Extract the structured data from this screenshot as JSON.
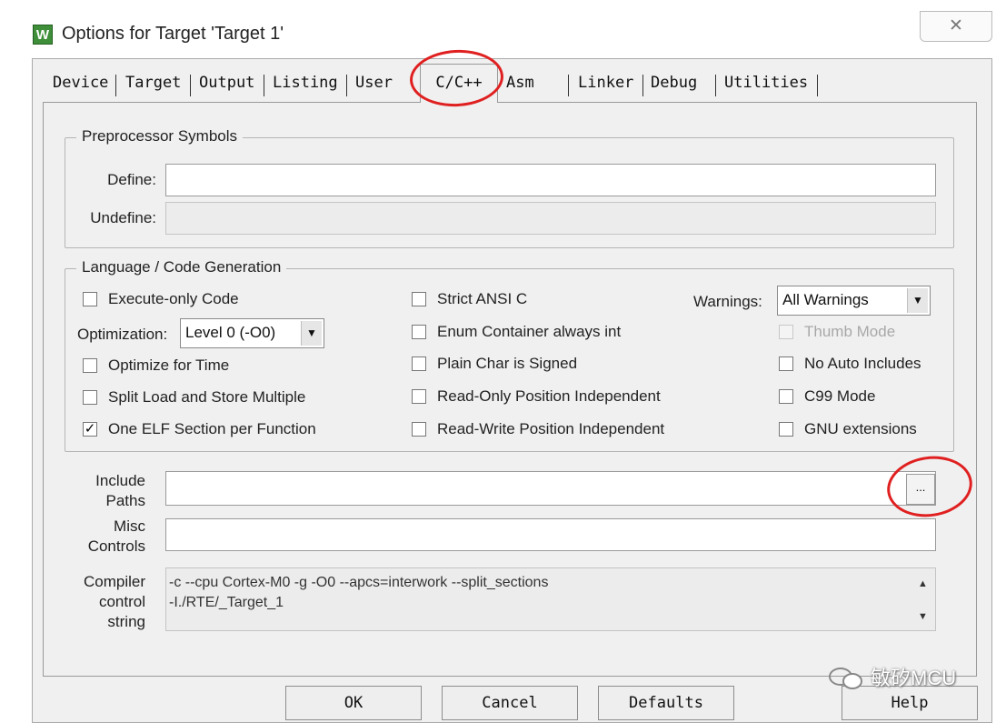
{
  "window": {
    "title": "Options for Target 'Target 1'",
    "close_glyph": "✕"
  },
  "tabs": [
    {
      "label": "Device"
    },
    {
      "label": "Target"
    },
    {
      "label": "Output"
    },
    {
      "label": "Listing"
    },
    {
      "label": "User"
    },
    {
      "label": "C/C++",
      "active": true
    },
    {
      "label": "Asm"
    },
    {
      "label": "Linker"
    },
    {
      "label": "Debug"
    },
    {
      "label": "Utilities"
    }
  ],
  "preprocessor": {
    "group_label": "Preprocessor Symbols",
    "define_label": "Define:",
    "define_value": "",
    "undefine_label": "Undefine:",
    "undefine_value": ""
  },
  "language": {
    "group_label": "Language / Code Generation",
    "execute_only": {
      "label": "Execute-only Code",
      "checked": false
    },
    "optimization": {
      "label": "Optimization:",
      "value": "Level 0 (-O0)"
    },
    "optimize_time": {
      "label": "Optimize for Time",
      "checked": false
    },
    "split_load": {
      "label": "Split Load and Store Multiple",
      "checked": false
    },
    "one_elf": {
      "label": "One ELF Section per Function",
      "checked": true
    },
    "strict_ansi": {
      "label": "Strict ANSI C",
      "checked": false
    },
    "enum_container": {
      "label": "Enum Container always int",
      "checked": false
    },
    "plain_char": {
      "label": "Plain Char is Signed",
      "checked": false
    },
    "ro_pi": {
      "label": "Read-Only Position Independent",
      "checked": false
    },
    "rw_pi": {
      "label": "Read-Write Position Independent",
      "checked": false
    },
    "warnings": {
      "label": "Warnings:",
      "value": "All Warnings"
    },
    "thumb_mode": {
      "label": "Thumb Mode",
      "checked": false,
      "disabled": true
    },
    "no_auto": {
      "label": "No Auto Includes",
      "checked": false
    },
    "c99": {
      "label": "C99 Mode",
      "checked": false
    },
    "gnu_ext": {
      "label": "GNU extensions",
      "checked": false
    }
  },
  "include_paths": {
    "label_line1": "Include",
    "label_line2": "Paths",
    "value": "",
    "browse_label": "..."
  },
  "misc_controls": {
    "label_line1": "Misc",
    "label_line2": "Controls",
    "value": ""
  },
  "compiler_string": {
    "label_line1": "Compiler",
    "label_line2": "control",
    "label_line3": "string",
    "line1": "-c --cpu Cortex-M0 -g -O0 --apcs=interwork --split_sections",
    "line2": "-I./RTE/_Target_1"
  },
  "buttons": {
    "ok": "OK",
    "cancel": "Cancel",
    "defaults": "Defaults",
    "help": "Help"
  },
  "watermark": {
    "text": "敏矽MCU"
  },
  "colors": {
    "annotation_red": "#e02020",
    "panel_bg": "#f0f0f0"
  }
}
